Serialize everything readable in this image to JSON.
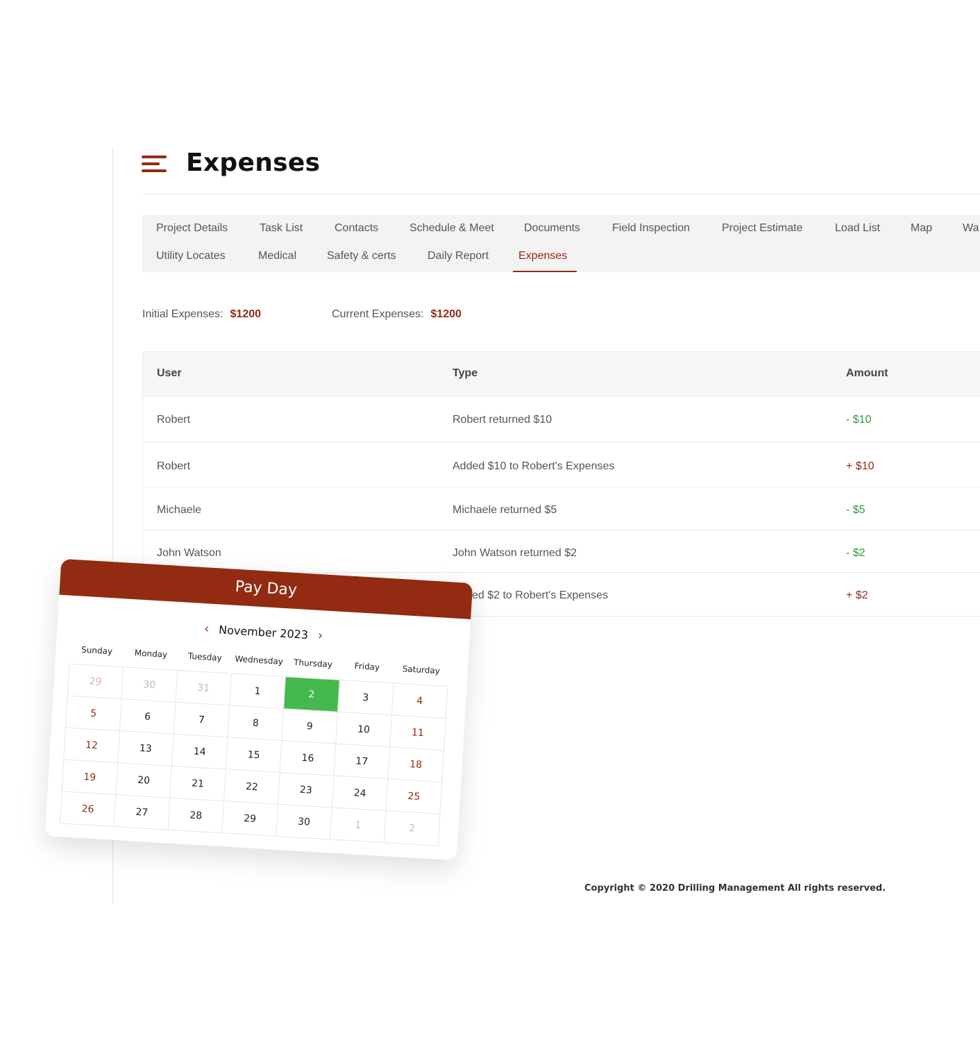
{
  "page": {
    "title": "Expenses"
  },
  "tabs": {
    "row1": [
      "Project Details",
      "Task List",
      "Contacts",
      "Schedule & Meet",
      "Documents",
      "Field Inspection",
      "Project Estimate",
      "Load List",
      "Map",
      "Wa"
    ],
    "row2": [
      "Utility Locates",
      "Medical",
      "Safety & certs",
      "Daily Report",
      "Expenses"
    ],
    "active": "Expenses"
  },
  "summary": {
    "initial_label": "Initial Expenses:",
    "initial_value": "$1200",
    "current_label": "Current Expenses:",
    "current_value": "$1200"
  },
  "table": {
    "headers": [
      "User",
      "Type",
      "Amount"
    ],
    "rows": [
      {
        "user": "Robert",
        "type": "Robert returned $10",
        "amount": "- $10",
        "sign": "negative"
      },
      {
        "user": "Robert",
        "type": "Added $10 to Robert's Expenses",
        "amount": "+ $10",
        "sign": "positive"
      },
      {
        "user": "Michaele",
        "type": "Michaele returned $5",
        "amount": "- $5",
        "sign": "negative"
      },
      {
        "user": "John Watson",
        "type": "John Watson returned $2",
        "amount": "- $2",
        "sign": "negative"
      },
      {
        "user": "",
        "type": "ed $2 to Robert's Expenses",
        "amount": "+ $2",
        "sign": "positive"
      }
    ]
  },
  "footer": {
    "copyright": "Copyright © 2020 Drilling Management All rights reserved."
  },
  "calendar": {
    "title": "Pay Day",
    "month": "November 2023",
    "prev_icon": "chevron-left-icon",
    "next_icon": "chevron-right-icon",
    "weekdays": [
      "Sunday",
      "Monday",
      "Tuesday",
      "Wednesday",
      "Thursday",
      "Friday",
      "Saturday"
    ],
    "weeks": [
      [
        "29",
        "30",
        "31",
        "1",
        "2",
        "3",
        "4"
      ],
      [
        "5",
        "6",
        "7",
        "8",
        "9",
        "10",
        "11"
      ],
      [
        "12",
        "13",
        "14",
        "15",
        "16",
        "17",
        "18"
      ],
      [
        "19",
        "20",
        "21",
        "22",
        "23",
        "24",
        "25"
      ],
      [
        "26",
        "27",
        "28",
        "29",
        "30",
        "1",
        "2"
      ]
    ],
    "selected": "2",
    "colors": {
      "header": "#922b12",
      "selected": "#44b84c",
      "weekend": "#922b12"
    }
  },
  "colors": {
    "accent": "#922b12",
    "positive_amount": "#922b12",
    "negative_amount": "#2e9a3a"
  }
}
